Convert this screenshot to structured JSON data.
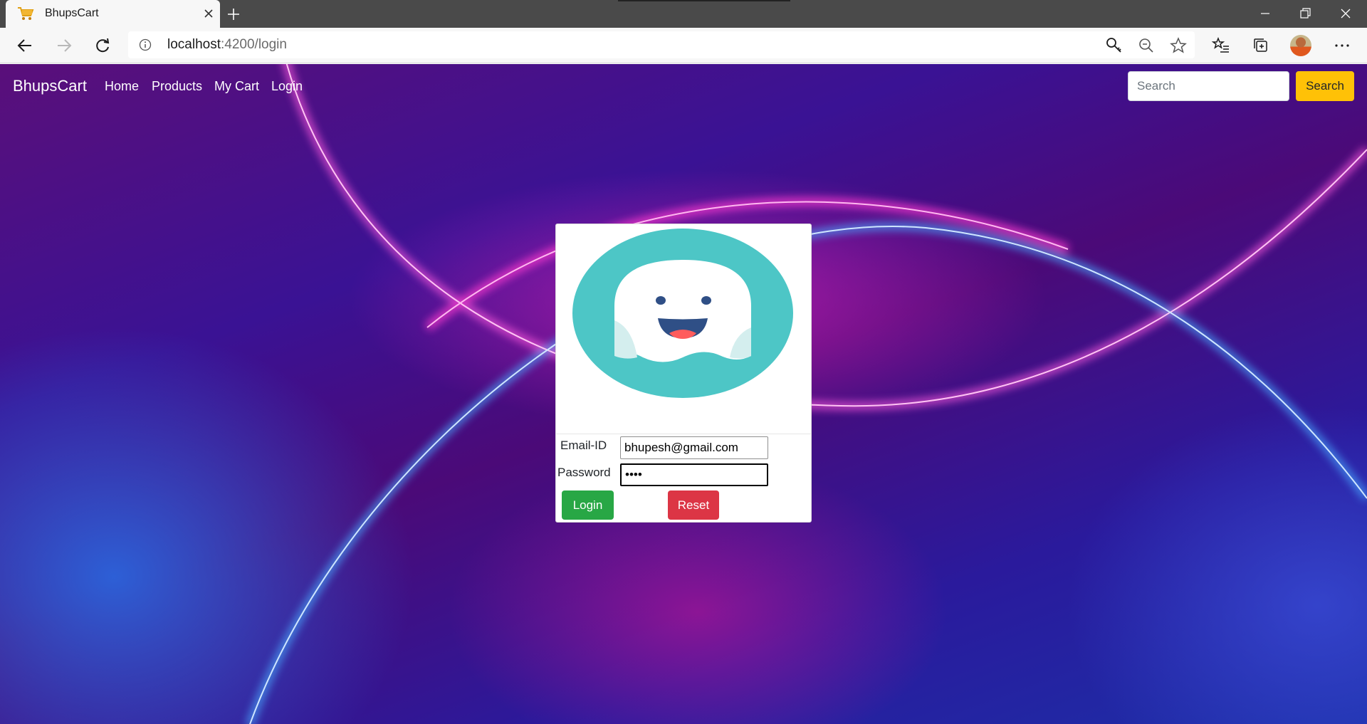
{
  "browser": {
    "tab_title": "BhupsCart",
    "url_host": "localhost",
    "url_rest": ":4200/login"
  },
  "navbar": {
    "brand": "BhupsCart",
    "links": [
      "Home",
      "Products",
      "My Cart",
      "Login"
    ],
    "search_placeholder": "Search",
    "search_button": "Search"
  },
  "login": {
    "email_label": "Email-ID",
    "email_value": "bhupesh@gmail.com",
    "password_label": "Password",
    "password_value": "••••",
    "login_button": "Login",
    "reset_button": "Reset"
  },
  "colors": {
    "login_button": "#28a745",
    "reset_button": "#dc3545",
    "search_button": "#ffc107",
    "logo_teal": "#4dc6c6"
  },
  "icons": [
    "cart-favicon-icon",
    "close-tab-icon",
    "new-tab-icon",
    "back-icon",
    "forward-icon",
    "refresh-icon",
    "info-icon",
    "key-icon",
    "zoom-out-icon",
    "star-icon",
    "favorites-icon",
    "collections-icon",
    "more-icon",
    "minimize-icon",
    "restore-icon",
    "close-window-icon"
  ]
}
